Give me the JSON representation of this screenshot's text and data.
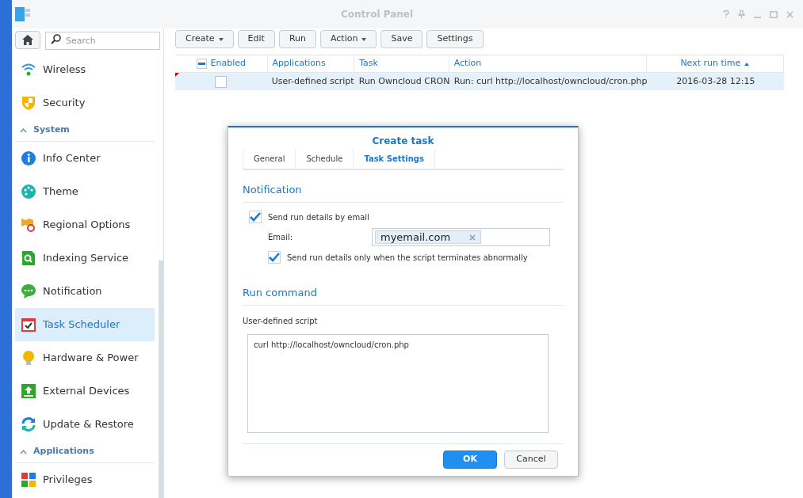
{
  "window": {
    "title": "Control Panel"
  },
  "sidebar": {
    "search": {
      "placeholder": "Search"
    },
    "items": [
      {
        "kind": "item",
        "label": "Wireless",
        "selected": false
      },
      {
        "kind": "item",
        "label": "Security",
        "selected": false
      },
      {
        "kind": "section",
        "label": "System",
        "expanded": true
      },
      {
        "kind": "item",
        "label": "Info Center",
        "selected": false
      },
      {
        "kind": "item",
        "label": "Theme",
        "selected": false
      },
      {
        "kind": "item",
        "label": "Regional Options",
        "selected": false
      },
      {
        "kind": "item",
        "label": "Indexing Service",
        "selected": false
      },
      {
        "kind": "item",
        "label": "Notification",
        "selected": false
      },
      {
        "kind": "item",
        "label": "Task Scheduler",
        "selected": true
      },
      {
        "kind": "item",
        "label": "Hardware & Power",
        "selected": false
      },
      {
        "kind": "item",
        "label": "External Devices",
        "selected": false
      },
      {
        "kind": "item",
        "label": "Update & Restore",
        "selected": false
      },
      {
        "kind": "section",
        "label": "Applications",
        "expanded": true
      },
      {
        "kind": "item",
        "label": "Privileges",
        "selected": false
      }
    ]
  },
  "toolbar": [
    {
      "label": "Create",
      "dropdown": true
    },
    {
      "label": "Edit",
      "dropdown": false
    },
    {
      "label": "Run",
      "dropdown": false
    },
    {
      "label": "Action",
      "dropdown": true
    },
    {
      "label": "Save",
      "dropdown": false
    },
    {
      "label": "Settings",
      "dropdown": false
    }
  ],
  "table": {
    "all_enabled_partial": true,
    "columns": [
      {
        "label": "Enabled",
        "sorted": false
      },
      {
        "label": "Applications",
        "sorted": false
      },
      {
        "label": "Task",
        "sorted": false
      },
      {
        "label": "Action",
        "sorted": false
      },
      {
        "label": "Next run time",
        "sorted": true
      }
    ],
    "rows": [
      {
        "enabled": false,
        "selected": true,
        "application": "User-defined script",
        "task": "Run Owncloud CRON",
        "action": "Run: curl http://localhost/owncloud/cron.php",
        "next_run_time": "2016-03-28 12:15"
      }
    ]
  },
  "dialog": {
    "title": "Create task",
    "tabs": [
      {
        "label": "General",
        "selected": false
      },
      {
        "label": "Schedule",
        "selected": false
      },
      {
        "label": "Task Settings",
        "selected": true
      }
    ],
    "notification": {
      "heading": "Notification",
      "send_email": {
        "label": "Send run details by email",
        "checked": true
      },
      "email_label": "Email:",
      "email_tags": [
        "myemail.com"
      ],
      "only_abnormal": {
        "label": "Send run details only when the script terminates abnormally",
        "checked": true
      }
    },
    "run_command": {
      "heading": "Run command",
      "label": "User-defined script",
      "value": "curl http://localhost/owncloud/cron.php"
    },
    "buttons": [
      {
        "label": "OK",
        "primary": true
      },
      {
        "label": "Cancel",
        "primary": false
      }
    ]
  }
}
